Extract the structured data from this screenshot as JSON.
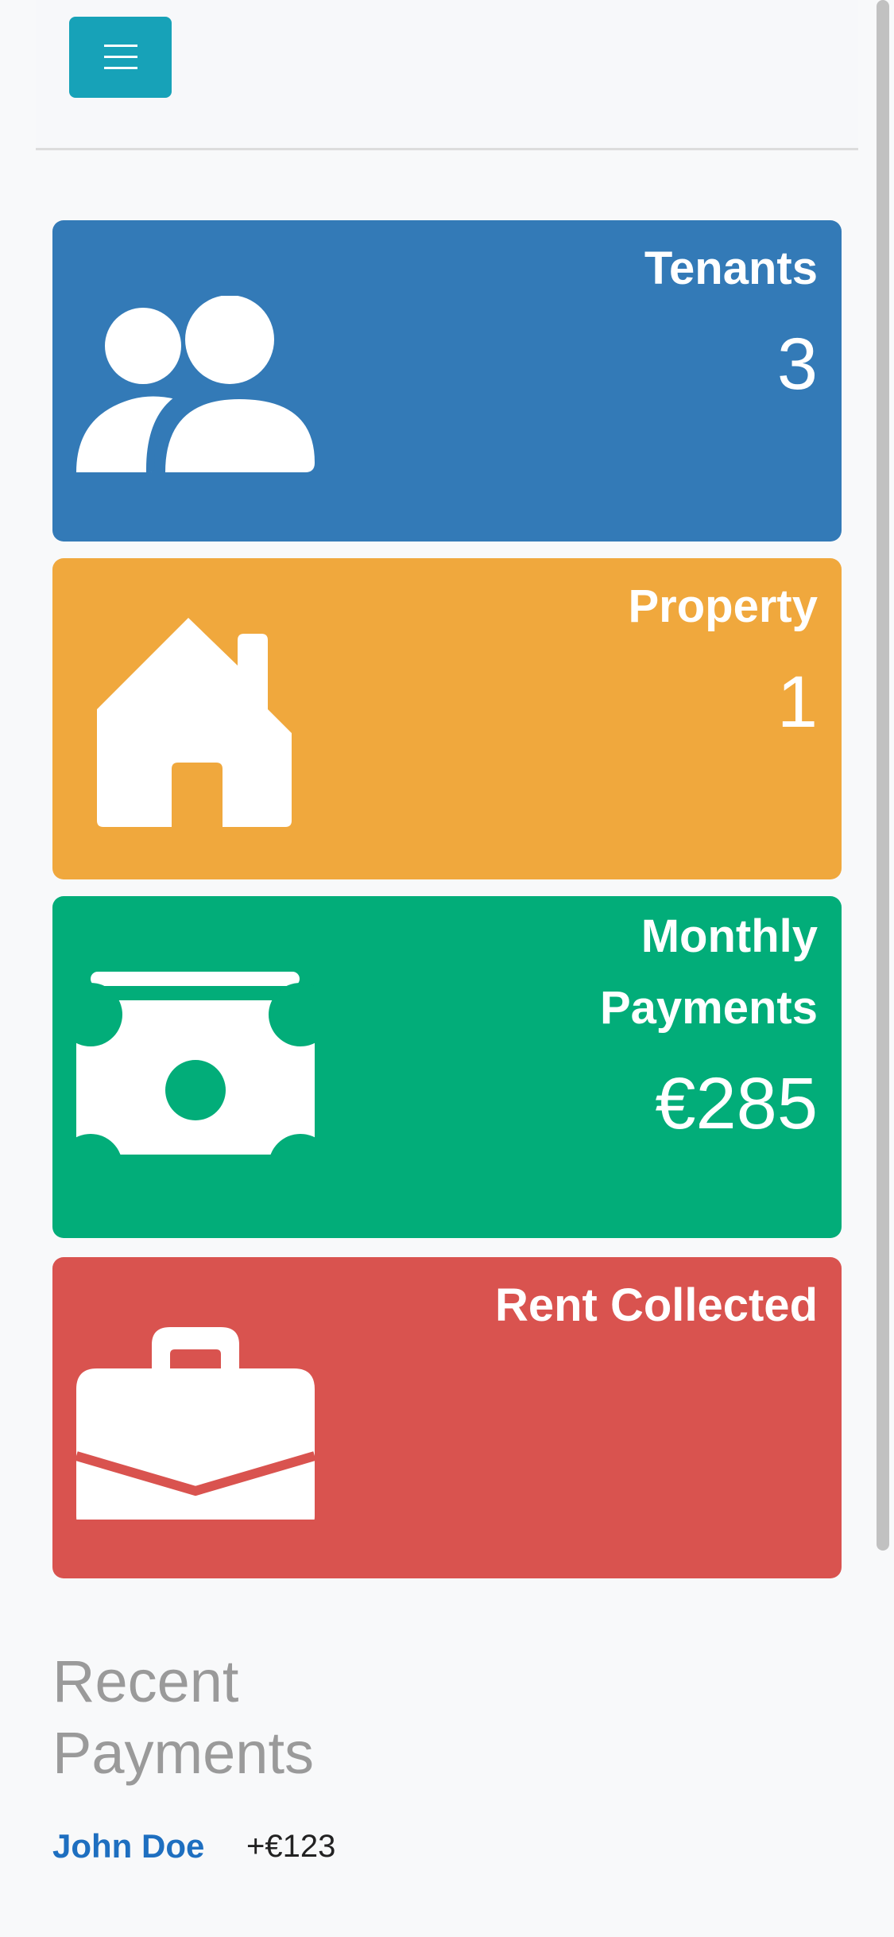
{
  "header": {
    "menu_icon": "hamburger-icon",
    "accent": "#17a2b8"
  },
  "cards": [
    {
      "title": "Tenants",
      "value": "3",
      "icon": "users-icon",
      "color": "#337ab7"
    },
    {
      "title": "Property",
      "value": "1",
      "icon": "house-icon",
      "color": "#f0a83d"
    },
    {
      "title": "Monthly Payments",
      "value": "€285",
      "icon": "money-bill-icon",
      "color": "#02ad79"
    },
    {
      "title": "Rent Collected",
      "value": "",
      "icon": "briefcase-icon",
      "color": "#d9534f"
    }
  ],
  "recent": {
    "title": "Recent Payments",
    "payments": [
      {
        "name": "John Doe",
        "amount": "+€123"
      }
    ]
  }
}
